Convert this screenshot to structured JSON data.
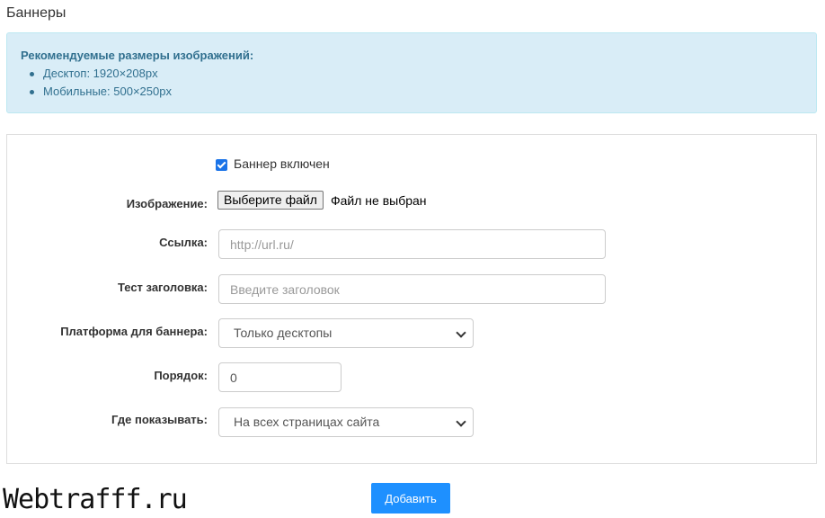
{
  "page": {
    "title": "Баннеры"
  },
  "info": {
    "title": "Рекомендуемые размеры изображений:",
    "items": [
      "Десктоп: 1920×208px",
      "Мобильные: 500×250px"
    ]
  },
  "form": {
    "enabled_checkbox": {
      "label": "Баннер включен",
      "checked": true
    },
    "image": {
      "label": "Изображение:",
      "button": "Выберите файл",
      "status": "Файл не выбран"
    },
    "link": {
      "label": "Ссылка:",
      "placeholder": "http://url.ru/",
      "value": ""
    },
    "heading": {
      "label": "Тест заголовка:",
      "placeholder": "Введите заголовок",
      "value": ""
    },
    "platform": {
      "label": "Платформа для баннера:",
      "selected": "Только десктопы"
    },
    "order": {
      "label": "Порядок:",
      "value": "0"
    },
    "where": {
      "label": "Где показывать:",
      "selected": "На всех страницах сайта"
    }
  },
  "actions": {
    "add_label": "Добавить"
  },
  "watermark": "Webtrafff.ru",
  "colors": {
    "accent": "#1e90ff",
    "info_bg": "#d9edf7",
    "info_text": "#31708f"
  }
}
